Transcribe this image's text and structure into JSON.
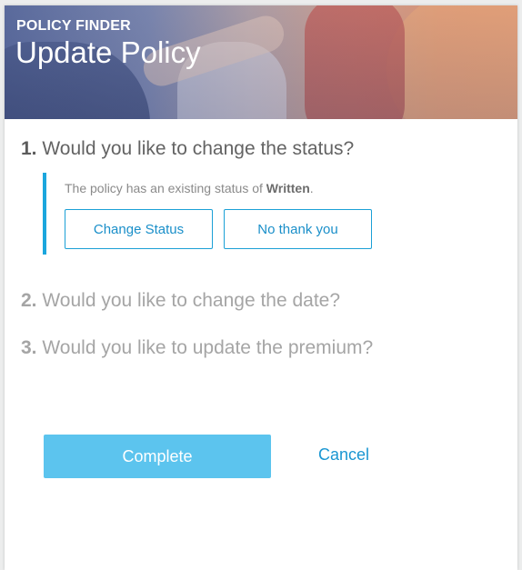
{
  "header": {
    "eyebrow": "POLICY FINDER",
    "title": "Update Policy"
  },
  "steps": [
    {
      "number": "1.",
      "question": "Would you like to change the status?",
      "active": true
    },
    {
      "number": "2.",
      "question": "Would you like to change the date?",
      "active": false
    },
    {
      "number": "3.",
      "question": "Would you like to update the premium?",
      "active": false
    }
  ],
  "status_step": {
    "description_prefix": "The policy has an existing status of ",
    "current_status": "Written",
    "description_suffix": ".",
    "change_button": "Change Status",
    "decline_button": "No thank you"
  },
  "footer": {
    "complete_label": "Complete",
    "cancel_label": "Cancel"
  },
  "colors": {
    "accent": "#1ba6dd",
    "primary_button": "#5cc4ee",
    "link": "#1a96d2"
  }
}
